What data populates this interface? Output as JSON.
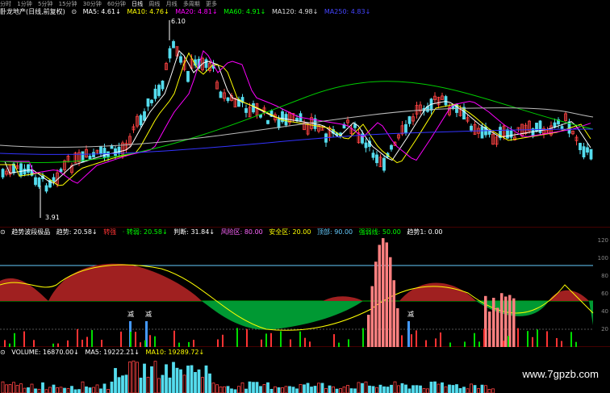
{
  "toolbar": {
    "items": [
      "分时",
      "1分钟",
      "5分钟",
      "15分钟",
      "30分钟",
      "60分钟",
      "日线",
      "周线",
      "月线",
      "多周期",
      "更多"
    ],
    "active_index": 6
  },
  "price_panel": {
    "title": "卧龙地产(日线,前复权)",
    "ma": [
      {
        "label": "MA5: 4.61↓",
        "color": "#ffffff"
      },
      {
        "label": "MA10: 4.76↓",
        "color": "#ffff00"
      },
      {
        "label": "MA20: 4.81↓",
        "color": "#ff00ff"
      },
      {
        "label": "MA60: 4.91↓",
        "color": "#00ff00"
      },
      {
        "label": "MA120: 4.98↓",
        "color": "#dddddd"
      },
      {
        "label": "MA250: 4.83↓",
        "color": "#4444ff"
      }
    ],
    "high_label": "6.10",
    "low_label": "3.91"
  },
  "indicator_panel": {
    "title": "趋势波段极品",
    "items": [
      {
        "label": "趋势: 20.58↓",
        "color": "#ffffff"
      },
      {
        "label": "转强",
        "color": "#ff3333"
      },
      {
        "label": "· 转弱: 20.58↓",
        "color": "#00ff00"
      },
      {
        "label": "判断: 31.84↓",
        "color": "#ffffff"
      },
      {
        "label": "风险区: 80.00",
        "color": "#ff66ff"
      },
      {
        "label": "安全区: 20.00",
        "color": "#ffff00"
      },
      {
        "label": "顶部: 90.00",
        "color": "#66ccff"
      },
      {
        "label": "强弱线: 50.00",
        "color": "#00ff00"
      },
      {
        "label": "趋势1: 0.00",
        "color": "#ffffff"
      }
    ],
    "markers": [
      "减",
      "减",
      "减"
    ],
    "axis": [
      "120",
      "100",
      "80",
      "60",
      "40",
      "20"
    ]
  },
  "volume_panel": {
    "items": [
      {
        "label": "VOLUME: 16870.00↓",
        "color": "#ffffff"
      },
      {
        "label": "MA5: 19222.21↓",
        "color": "#ffffff"
      },
      {
        "label": "MA10: 19289.72↓",
        "color": "#ffff00"
      }
    ]
  },
  "watermark": "www.7gpzb.com",
  "colors": {
    "up": "#ff4444",
    "down": "#55ddee",
    "bg": "#000000"
  }
}
